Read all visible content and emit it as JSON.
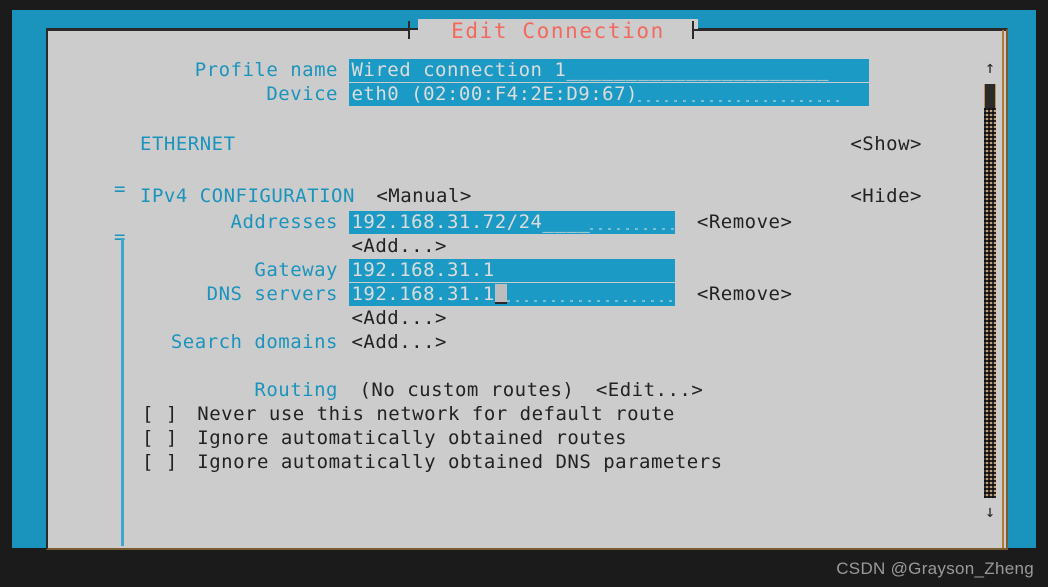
{
  "window": {
    "title": "Edit Connection"
  },
  "form": {
    "profile_name": {
      "label": "Profile name",
      "value": "Wired connection 1",
      "fill_solid": "______________________",
      "fill_dotted": ""
    },
    "device": {
      "label": "Device",
      "value": "eth0 (02:00:F4:2E:D9:67)",
      "fill_solid": "",
      "fill_dotted": "................."
    }
  },
  "ethernet_section": {
    "marker": "=",
    "title": "ETHERNET",
    "action": "<Show>"
  },
  "ipv4_section": {
    "marker": "=",
    "title": "IPv4 CONFIGURATION",
    "method": "<Manual>",
    "action": "<Hide>",
    "addresses": {
      "label": "Addresses",
      "value": "192.168.31.72/24",
      "fill_solid": "____",
      "fill_dotted": "..........",
      "remove_label": "<Remove>",
      "add_label": "<Add...>"
    },
    "gateway": {
      "label": "Gateway",
      "value": "192.168.31.1",
      "fill_solid": "",
      "fill_dotted": "..................."
    },
    "dns_servers": {
      "label": "DNS servers",
      "value": "192.168.31.1",
      "fill_solid": "",
      "fill_dotted": "..................",
      "remove_label": "<Remove>",
      "add_label": "<Add...>"
    },
    "search_domains": {
      "label": "Search domains",
      "add_label": "<Add...>"
    },
    "routing": {
      "label": "Routing",
      "status": "(No custom routes)",
      "edit_label": "<Edit...>"
    },
    "checkboxes": [
      {
        "box": "[ ]",
        "label": "Never use this network for default route",
        "checked": false
      },
      {
        "box": "[ ]",
        "label": "Ignore automatically obtained routes",
        "checked": false
      },
      {
        "box": "[ ]",
        "label": "Ignore automatically obtained DNS parameters",
        "checked": false
      }
    ]
  },
  "scrollbar": {
    "up_arrow": "↑",
    "down_arrow": "↓"
  },
  "watermark": {
    "text": "CSDN @Grayson_Zheng"
  },
  "colors": {
    "terminal_bg": "#1a94bd",
    "dialog_bg": "#cccccc",
    "label_cyan": "#1a94bd",
    "field_bg": "#1a9ac4",
    "title_red": "#f4685e",
    "text_dark": "#222222",
    "page_bg": "#1b1b1b"
  }
}
